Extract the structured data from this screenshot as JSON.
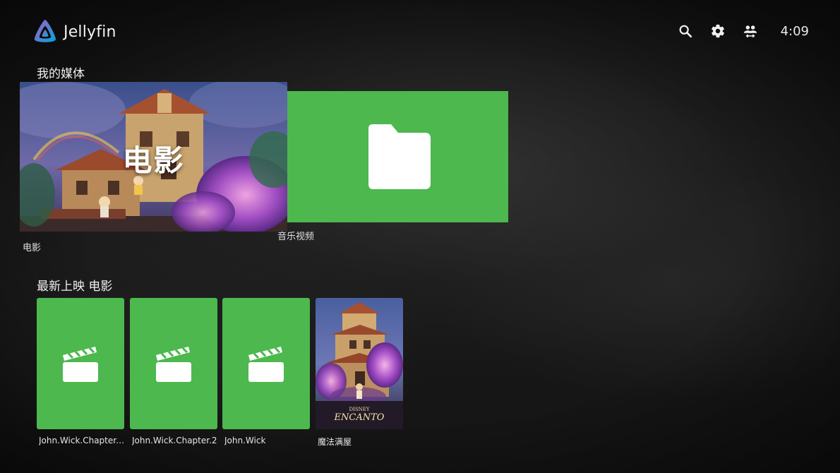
{
  "app": {
    "name": "Jellyfin",
    "logo_icon": "jellyfin-logo-icon"
  },
  "toolbar": {
    "search_icon": "search-icon",
    "settings_icon": "gear-icon",
    "users_icon": "switch-user-icon",
    "clock": "4:09"
  },
  "my_media": {
    "title": "我的媒体",
    "libraries": [
      {
        "label": "电影",
        "overlay_title": "电影",
        "icon": "movie-artwork"
      },
      {
        "label": "音乐视频",
        "icon": "folder-icon"
      }
    ]
  },
  "latest": {
    "title": "最新上映 电影",
    "items": [
      {
        "label": "John.Wick.Chapter.3...",
        "icon": "clapperboard-icon"
      },
      {
        "label": "John.Wick.Chapter.2",
        "icon": "clapperboard-icon"
      },
      {
        "label": "John.Wick",
        "icon": "clapperboard-icon"
      },
      {
        "label": "魔法满屋",
        "poster_text": "ENCANTO",
        "poster_brand": "DISNEY"
      }
    ]
  },
  "colors": {
    "placeholder_green": "#4cb84e",
    "background": "#161616",
    "text": "#ffffff"
  }
}
